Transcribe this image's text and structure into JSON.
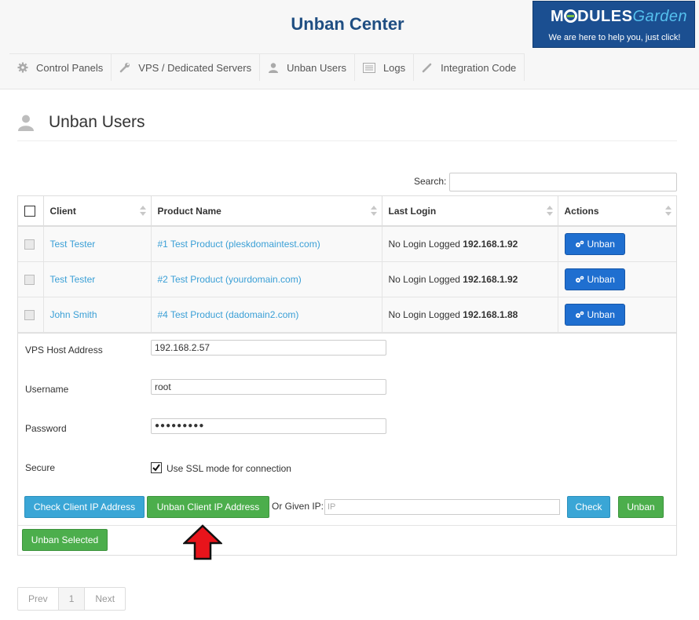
{
  "header": {
    "title": "Unban Center",
    "brand": {
      "logo_left": "M",
      "logo_mid": "DULES",
      "logo_right": "Garden",
      "tagline": "We are here to help you, just click!"
    }
  },
  "nav": [
    {
      "label": "Control Panels",
      "icon": "gear-icon"
    },
    {
      "label": "VPS / Dedicated Servers",
      "icon": "wrench-icon"
    },
    {
      "label": "Unban Users",
      "icon": "user-icon"
    },
    {
      "label": "Logs",
      "icon": "list-icon"
    },
    {
      "label": "Integration Code",
      "icon": "pencil-icon"
    }
  ],
  "page": {
    "title": "Unban Users",
    "icon": "user-icon"
  },
  "search": {
    "label": "Search:"
  },
  "table": {
    "columns": [
      "Client",
      "Product Name",
      "Last Login",
      "Actions"
    ],
    "rows": [
      {
        "client": "Test Tester",
        "product": "#1 Test Product (pleskdomaintest.com)",
        "login_prefix": "No Login Logged",
        "ip": "192.168.1.92",
        "action": "Unban"
      },
      {
        "client": "Test Tester",
        "product": "#2 Test Product (yourdomain.com)",
        "login_prefix": "No Login Logged",
        "ip": "192.168.1.92",
        "action": "Unban"
      },
      {
        "client": "John Smith",
        "product": "#4 Test Product (dadomain2.com)",
        "login_prefix": "No Login Logged",
        "ip": "192.168.1.88",
        "action": "Unban"
      }
    ]
  },
  "form": {
    "vps_host": {
      "label": "VPS Host Address",
      "value": "192.168.2.57"
    },
    "username": {
      "label": "Username",
      "value": "root"
    },
    "password": {
      "label": "Password",
      "value": "●●●●●●●●●"
    },
    "secure": {
      "label": "Secure",
      "option": "Use SSL mode for connection",
      "checked": true
    },
    "check_client_ip": "Check Client IP Address",
    "unban_client_ip": "Unban Client IP Address",
    "given_ip_label": "Or Given IP:",
    "given_ip_placeholder": "IP",
    "check": "Check",
    "unban": "Unban",
    "unban_selected": "Unban Selected"
  },
  "pager": {
    "prev": "Prev",
    "page": "1",
    "next": "Next"
  },
  "colors": {
    "title": "#1f4e82",
    "brand_bg": "#1b4f91",
    "link": "#3a9fd6",
    "row_button": "#1f6fd0",
    "green": "#4cae4c",
    "blue_btn": "#3aa6d6",
    "arrow": "#e8141b"
  }
}
